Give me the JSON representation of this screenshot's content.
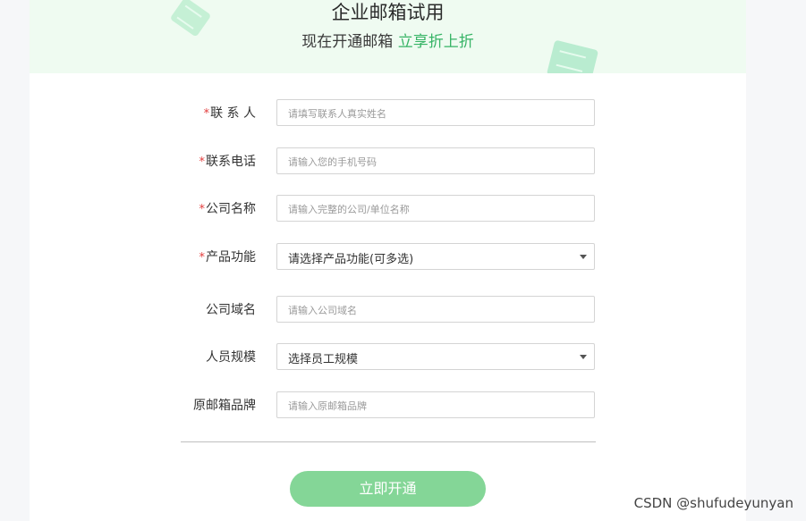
{
  "header": {
    "title": "企业邮箱试用",
    "subtitle_prefix": "现在开通邮箱 ",
    "subtitle_highlight": "立享折上折"
  },
  "form": {
    "required_mark": "*",
    "fields": [
      {
        "label": "联 系 人",
        "placeholder": "请填写联系人真实姓名"
      },
      {
        "label": "联系电话",
        "placeholder": "请输入您的手机号码"
      },
      {
        "label": "公司名称",
        "placeholder": "请输入完整的公司/单位名称"
      },
      {
        "label": "产品功能",
        "value": "请选择产品功能(可多选)"
      },
      {
        "label": "公司域名",
        "placeholder": "请输入公司域名"
      },
      {
        "label": "人员规模",
        "value": "选择员工规模"
      },
      {
        "label": "原邮箱品牌",
        "placeholder": "请输入原邮箱品牌"
      }
    ],
    "submit_label": "立即开通"
  },
  "watermark": "CSDN @shufudeyunyan",
  "colors": {
    "accent": "#37b466",
    "button": "#84d697",
    "banner_bg": "#effbf1",
    "required": "#e33d3d"
  },
  "icons": [
    "envelope-icon",
    "envelope-icon",
    "chevron-down-icon"
  ]
}
